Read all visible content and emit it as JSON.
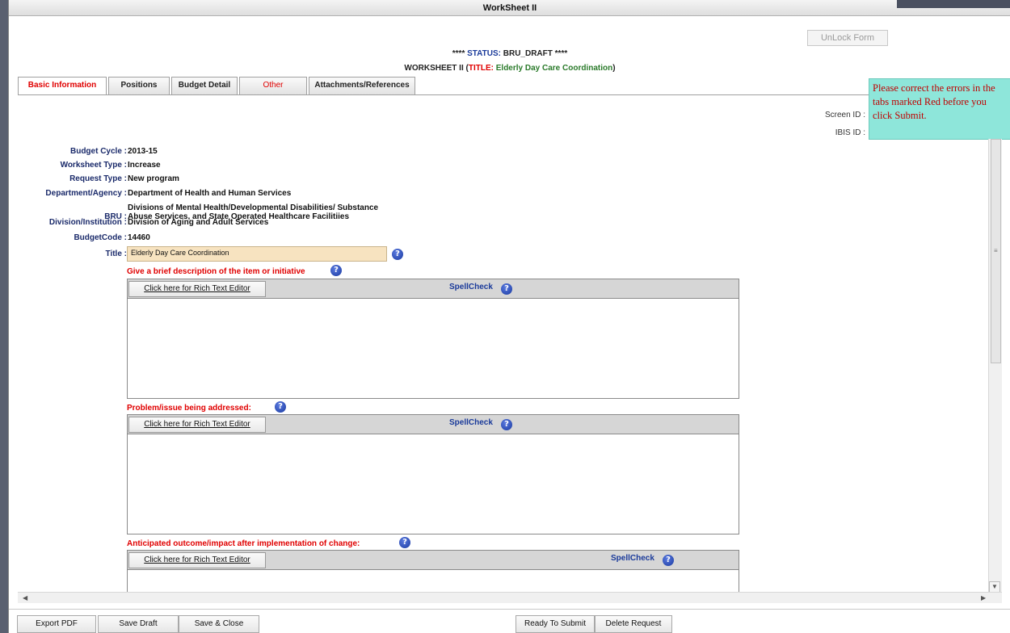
{
  "window": {
    "title": "WorkSheet II"
  },
  "toolbar": {
    "unlock_label": "UnLock Form"
  },
  "status": {
    "prefix": "****",
    "label": "STATUS:",
    "value": "BRU_DRAFT",
    "suffix": "****"
  },
  "worksheet_title": {
    "prefix": "WORKSHEET II (",
    "title_label": "TITLE:",
    "title_value": "Elderly Day Care Coordination",
    "suffix": ")"
  },
  "tabs": [
    {
      "label": "Basic Information",
      "state": "active"
    },
    {
      "label": "Positions",
      "state": "normal"
    },
    {
      "label": "Budget Detail",
      "state": "normal"
    },
    {
      "label": "Other",
      "state": "error"
    },
    {
      "label": "Attachments/References",
      "state": "normal"
    }
  ],
  "tooltip": {
    "text": "Please correct the errors in the tabs marked Red before you click Submit."
  },
  "ids": {
    "screen_label": "Screen ID :",
    "ibis_label": "IBIS ID :"
  },
  "fields": {
    "budget_cycle": {
      "label": "Budget Cycle :",
      "value": "2013-15"
    },
    "worksheet_type": {
      "label": "Worksheet Type :",
      "value": "Increase"
    },
    "request_type": {
      "label": "Request Type :",
      "value": "New program"
    },
    "department": {
      "label": "Department/Agency :",
      "value": "Department of Health and Human Services"
    },
    "bru": {
      "label": "BRU :",
      "value": "Divisions of Mental Health/Developmental Disabilities/ Substance Abuse Services, and State Operated Healthcare Facilitiies"
    },
    "division": {
      "label": "Division/Institution :",
      "value": "Division of Aging and Adult Services"
    },
    "budget_code": {
      "label": "BudgetCode :",
      "value": "14460"
    },
    "title": {
      "label": "Title :",
      "value": "Elderly Day Care Coordination"
    }
  },
  "sections": [
    {
      "label": "Give a brief description of the item or initiative",
      "rte_label": "Click here for Rich Text Editor",
      "spell_label": "SpellCheck",
      "content": ""
    },
    {
      "label": "Problem/issue being addressed:",
      "rte_label": "Click here for Rich Text Editor",
      "spell_label": "SpellCheck",
      "content": ""
    },
    {
      "label": "Anticipated outcome/impact after implementation of change:",
      "rte_label": "Click here for Rich Text Editor",
      "spell_label": "SpellCheck",
      "content": ""
    }
  ],
  "help_glyph": "?",
  "footer": {
    "export_pdf": "Export PDF",
    "save_draft": "Save Draft",
    "save_close": "Save & Close",
    "ready_submit": "Ready To Submit",
    "delete_request": "Delete Request"
  },
  "colors": {
    "error": "#e00000",
    "label_blue": "#1a2a6a",
    "title_green": "#2a7a2a",
    "tooltip_bg": "#8ee6da",
    "title_field_bg": "#f7e3c0"
  }
}
